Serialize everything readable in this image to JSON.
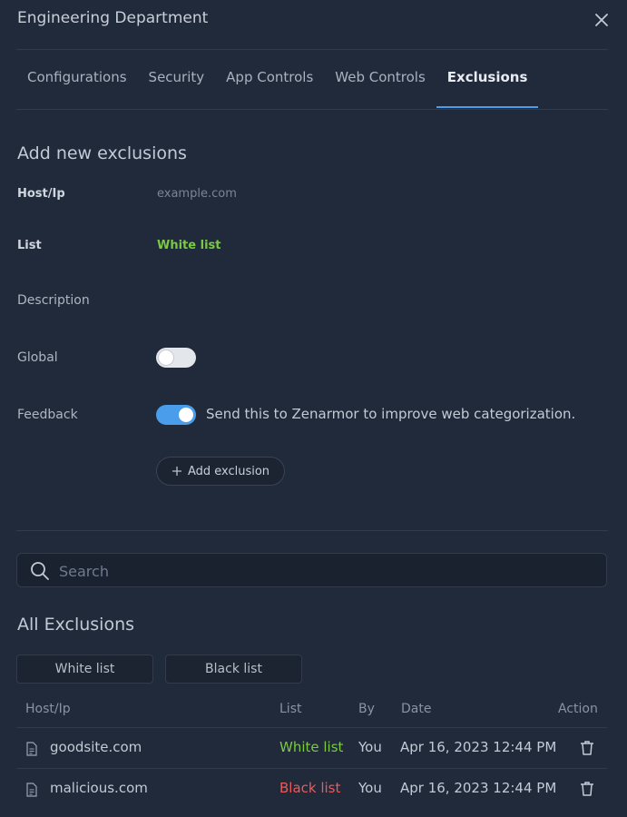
{
  "header": {
    "title": "Engineering Department"
  },
  "tabs": [
    {
      "label": "Configurations"
    },
    {
      "label": "Security"
    },
    {
      "label": "App Controls"
    },
    {
      "label": "Web Controls"
    },
    {
      "label": "Exclusions",
      "active": true
    }
  ],
  "form": {
    "title": "Add new exclusions",
    "host_label": "Host/Ip",
    "host_placeholder": "example.com",
    "list_label": "List",
    "list_value": "White list",
    "description_label": "Description",
    "global_label": "Global",
    "global_on": false,
    "feedback_label": "Feedback",
    "feedback_on": true,
    "feedback_text": "Send this to Zenarmor to improve web categorization.",
    "add_button": "Add exclusion"
  },
  "search": {
    "placeholder": "Search"
  },
  "list": {
    "title": "All Exclusions",
    "filters": [
      "White list",
      "Black list"
    ],
    "columns": [
      "Host/Ip",
      "List",
      "By",
      "Date",
      "Action"
    ],
    "rows": [
      {
        "host": "goodsite.com",
        "list": "White list",
        "by": "You",
        "date": "Apr 16, 2023 12:44 PM"
      },
      {
        "host": "malicious.com",
        "list": "Black list",
        "by": "You",
        "date": "Apr 16, 2023 12:44 PM"
      }
    ]
  },
  "colors": {
    "accent": "#4a9dea",
    "white_list": "#7ac943",
    "black_list": "#ec5a5a",
    "background": "#212a3a"
  }
}
